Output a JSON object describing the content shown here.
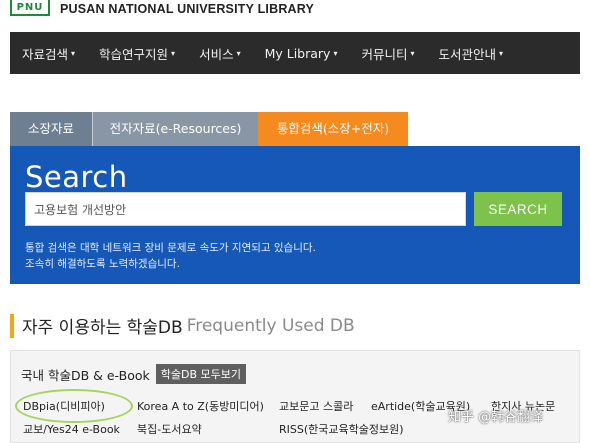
{
  "header": {
    "logo_text": "PNU",
    "site_title": "PUSAN NATIONAL UNIVERSITY LIBRARY"
  },
  "nav": {
    "items": [
      {
        "label": "자료검색"
      },
      {
        "label": "학습연구지원"
      },
      {
        "label": "서비스"
      },
      {
        "label": "My Library"
      },
      {
        "label": "커뮤니티"
      },
      {
        "label": "도서관안내"
      }
    ],
    "caret": "▾"
  },
  "search": {
    "tabs": [
      {
        "label": "소장자료"
      },
      {
        "label": "전자자료(e-Resources)"
      },
      {
        "label": "통합검색(소장+전자)"
      }
    ],
    "heading": "Search",
    "input_value": "고용보험 개선방안",
    "button_label": "SEARCH",
    "notice_line1": "통합 검색은 대학 네트워크 장비 문제로 속도가 지연되고 있습니다.",
    "notice_line2": "조속히 해결하도록 노력하겠습니다."
  },
  "frequent_db": {
    "title_ko": "자주 이용하는 학술DB",
    "title_en": "Frequently Used DB",
    "section_label": "국내 학술DB & e-Book",
    "view_all_label": "학술DB 모두보기",
    "row1": [
      "DBpia(디비피아)",
      "Korea A to Z(동방미디어)",
      "교보문고 스콜라",
      "eArtide(학술교육원)",
      "한지사 뉴논문"
    ],
    "row2": [
      "교보/Yes24 e-Book",
      "북집-도서요약",
      "RISS(한국교육학술정보원)"
    ]
  },
  "watermark": "知乎 @韩谷翻译",
  "colors": {
    "nav_bg": "#2b2b2b",
    "search_panel": "#1658b8",
    "active_tab": "#f58a1f",
    "search_button": "#7dc24a",
    "section_accent": "#f2a71b",
    "highlight_ring": "#a6d35a"
  }
}
